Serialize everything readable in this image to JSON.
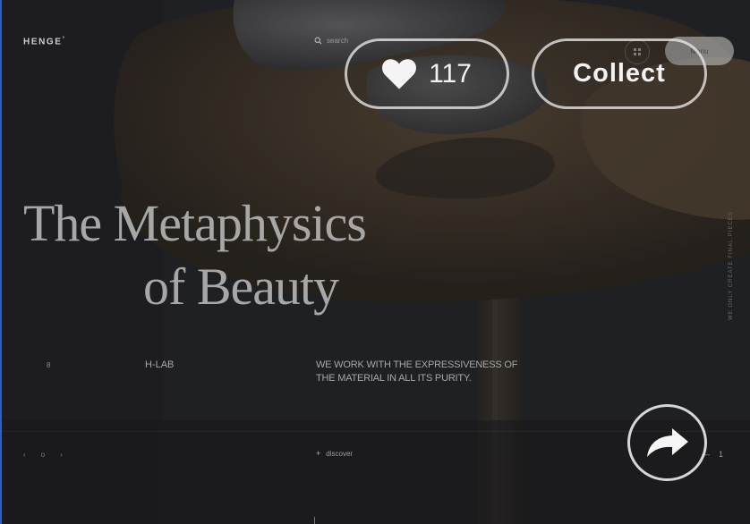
{
  "header": {
    "logo": "HENGE",
    "logo_mark": "°",
    "search_label": "search",
    "menu_label": "Menu"
  },
  "actions": {
    "likes_count": "117",
    "collect_label": "Collect"
  },
  "hero": {
    "line1": "The Metaphysics",
    "line2": "of Beauty"
  },
  "info": {
    "slide_number": "8",
    "lab_label": "H-LAB",
    "tagline": "WE WORK WITH THE EXPRESSIVENESS OF THE MATERIAL IN ALL ITS PURITY."
  },
  "side_text": "WE ONLY CREATE FINAL PIECES",
  "footer": {
    "pager": [
      "‹",
      "o",
      "›"
    ],
    "discover_plus": "+",
    "discover_label": "discover",
    "arrow_prev": "—",
    "arrow_next": "1"
  },
  "icons": {
    "search": "search-icon",
    "grid": "grid-icon",
    "heart": "heart-icon",
    "share": "share-arrow-icon"
  },
  "colors": {
    "background": "#1c1d20",
    "table_wood": "#4a3d2e",
    "button_border": "#ebebeb",
    "hero_text": "#a7a7a7"
  }
}
